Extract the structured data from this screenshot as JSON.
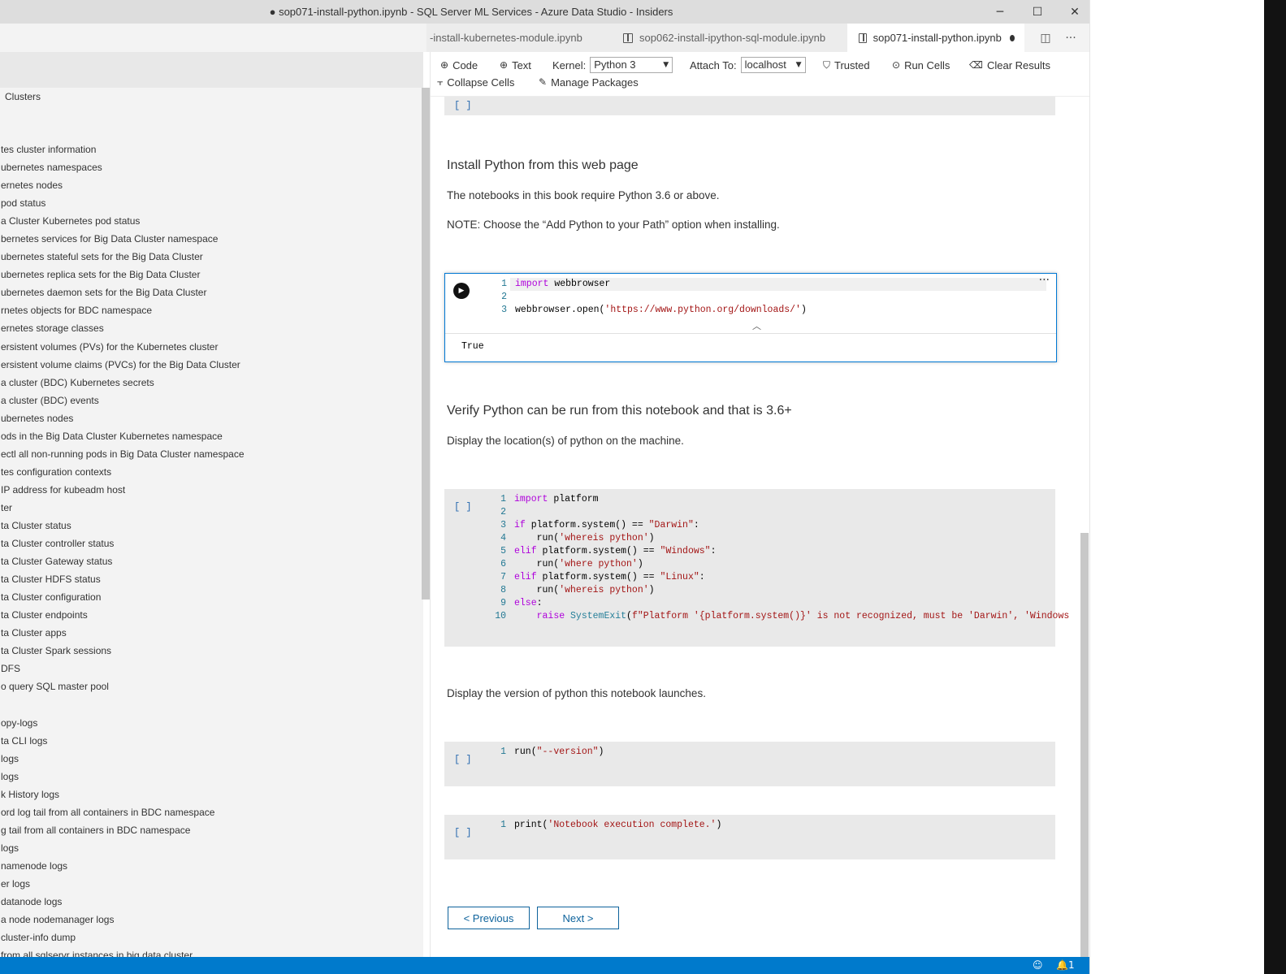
{
  "window": {
    "title": "● sop071-install-python.ipynb - SQL Server ML Services - Azure Data Studio - Insiders",
    "controls": {
      "minimize": "─",
      "maximize": "☐",
      "close": "✕"
    }
  },
  "tabs": [
    {
      "label": "-install-kubernetes-module.ipynb"
    },
    {
      "label": "sop062-install-ipython-sql-module.ipynb"
    },
    {
      "label": "sop071-install-python.ipynb"
    }
  ],
  "tab_actions": {
    "split": "◫",
    "more": "···"
  },
  "sidebar": {
    "section": "Clusters",
    "items": [
      "tes cluster information",
      "ubernetes namespaces",
      "ernetes nodes",
      "pod status",
      "a Cluster Kubernetes pod status",
      "bernetes services for Big Data Cluster namespace",
      "ubernetes stateful sets for the Big Data Cluster",
      "ubernetes replica sets for the Big Data Cluster",
      "ubernetes daemon sets for the Big Data Cluster",
      "rnetes objects for BDC namespace",
      "ernetes storage classes",
      "ersistent volumes (PVs) for the Kubernetes cluster",
      "ersistent volume claims (PVCs) for the Big Data Cluster",
      "a cluster (BDC) Kubernetes secrets",
      "a cluster (BDC) events",
      "ubernetes nodes",
      "ods in the Big Data Cluster Kubernetes namespace",
      "ectl all non-running pods in Big Data Cluster namespace",
      "tes configuration contexts",
      "IP address for kubeadm host",
      "ter",
      "ta Cluster status",
      "ta Cluster controller status",
      "ta Cluster Gateway status",
      "ta Cluster HDFS status",
      "ta Cluster configuration",
      "ta Cluster endpoints",
      "ta Cluster apps",
      "ta Cluster Spark sessions",
      "DFS",
      "o query SQL master pool",
      "",
      "opy-logs",
      "ta CLI logs",
      "logs",
      "logs",
      "k History logs",
      "ord log tail from all containers in BDC namespace",
      "g tail from all containers in BDC namespace",
      "logs",
      "namenode logs",
      "er logs",
      "datanode logs",
      "a node nodemanager logs",
      "cluster-info dump",
      "from all sqlservr instances in big data cluster"
    ]
  },
  "toolbar": {
    "code": "Code",
    "text": "Text",
    "kernel_label": "Kernel:",
    "kernel_value": "Python 3",
    "attach_label": "Attach To:",
    "attach_value": "localhost",
    "trusted": "Trusted",
    "run_cells": "Run Cells",
    "clear_results": "Clear Results",
    "collapse_cells": "Collapse Cells",
    "manage_packages": "Manage Packages"
  },
  "cells": {
    "empty_bracket": "[ ]",
    "md1": {
      "heading": "Install Python from this web page",
      "p1": "The notebooks in this book require Python 3.6 or above.",
      "p2": "NOTE: Choose the “Add Python to your Path” option when installing."
    },
    "code1": {
      "line_numbers": [
        "1",
        "2",
        "3"
      ],
      "l1_kw": "import",
      "l1_rest": " webbrowser",
      "l3_pre": "webbrowser.open(",
      "l3_str": "'https://www.python.org/downloads/'",
      "l3_post": ")",
      "output": "True",
      "more": "···",
      "collapse": "︿"
    },
    "md2": {
      "heading": "Verify Python can be run from this notebook and that is 3.6+",
      "p1": "Display the location(s) of python on the machine."
    },
    "code2": {
      "line_numbers": [
        "1",
        "2",
        "3",
        "4",
        "5",
        "6",
        "7",
        "8",
        "9",
        "10"
      ],
      "l1_kw": "import",
      "l1_rest": " platform",
      "l3_kw": "if",
      "l3_mid": " platform.system() == ",
      "l3_str": "\"Darwin\"",
      "l3_end": ":",
      "l4_pre": "    run(",
      "l4_str": "'whereis python'",
      "l4_end": ")",
      "l5_kw": "elif",
      "l5_mid": " platform.system() == ",
      "l5_str": "\"Windows\"",
      "l5_end": ":",
      "l6_pre": "    run(",
      "l6_str": "'where python'",
      "l6_end": ")",
      "l7_kw": "elif",
      "l7_mid": " platform.system() == ",
      "l7_str": "\"Linux\"",
      "l7_end": ":",
      "l8_pre": "    run(",
      "l8_str": "'whereis python'",
      "l8_end": ")",
      "l9_kw": "else",
      "l9_end": ":",
      "l10_indent": "    ",
      "l10_kw": "raise",
      "l10_sp": " ",
      "l10_bi": "SystemExit",
      "l10_open": "(",
      "l10_str": "f\"Platform '{platform.system()}' is not recognized, must be 'Darwin', 'Windows"
    },
    "md3": {
      "p1": "Display the version of python this notebook launches."
    },
    "code3": {
      "line": "1",
      "pre": "run(",
      "str": "\"--version\"",
      "post": ")"
    },
    "code4": {
      "line": "1",
      "pre": "print(",
      "str": "'Notebook execution complete.'",
      "post": ")"
    }
  },
  "nav": {
    "previous": "< Previous",
    "next": "Next >"
  },
  "statusbar": {
    "feedback": "☺",
    "notifications": "🔔1"
  },
  "colors": {
    "accent": "#007acc",
    "active_border": "#0078d4",
    "keyword": "#af00db",
    "string": "#a31515",
    "builtin": "#267f99"
  }
}
